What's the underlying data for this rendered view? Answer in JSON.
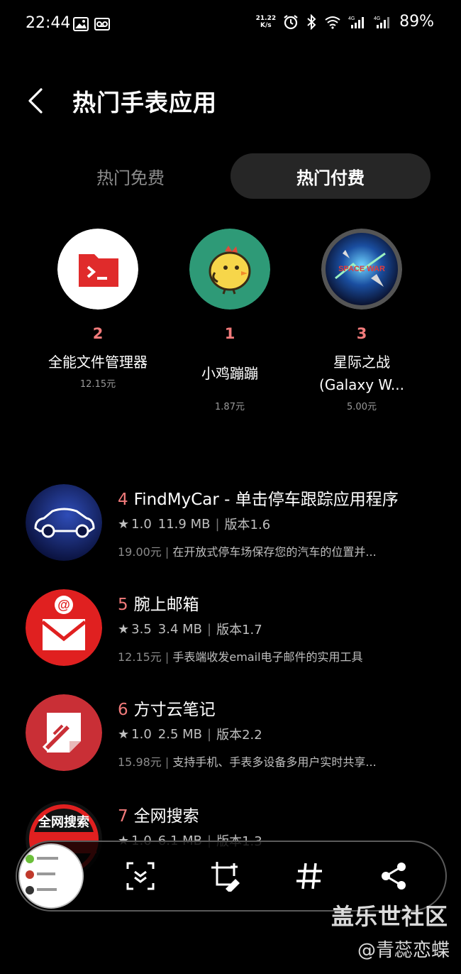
{
  "status": {
    "time": "22:44",
    "speed_top": "21.22",
    "speed_bottom": "K/s",
    "battery": "89%"
  },
  "header": {
    "title": "热门手表应用"
  },
  "tabs": [
    {
      "label": "热门免费",
      "active": false
    },
    {
      "label": "热门付费",
      "active": true
    }
  ],
  "top_apps": [
    {
      "rank": "2",
      "name": "全能文件管理器",
      "price": "12.15元",
      "icon": "folder-terminal-icon"
    },
    {
      "rank": "1",
      "name": "小鸡蹦蹦",
      "price": "1.87元",
      "icon": "chick-icon"
    },
    {
      "rank": "3",
      "name": "星际之战(Galaxy W...",
      "price": "5.00元",
      "icon": "space-war-icon"
    }
  ],
  "apps": [
    {
      "rank": "4",
      "name": "FindMyCar - 单击停车跟踪应用程序",
      "rating": "1.0",
      "size": "11.9 MB",
      "version": "版本1.6",
      "price": "19.00元",
      "desc": "在开放式停车场保存您的汽车的位置并..."
    },
    {
      "rank": "5",
      "name": "腕上邮箱",
      "rating": "3.5",
      "size": "3.4 MB",
      "version": "版本1.7",
      "price": "12.15元",
      "desc": "手表端收发email电子邮件的实用工具"
    },
    {
      "rank": "6",
      "name": "方寸云笔记",
      "rating": "1.0",
      "size": "2.5 MB",
      "version": "版本2.2",
      "price": "15.98元",
      "desc": "支持手机、手表多设备多用户实时共享..."
    },
    {
      "rank": "7",
      "name": "全网搜索",
      "rating": "1.0",
      "size": "6.1 MB",
      "version": "版本1.3",
      "price": "",
      "desc": ""
    }
  ],
  "icon7_text": "全网搜索",
  "watermark": {
    "line1": "盖乐世社区",
    "line2": "@青蕊恋蝶"
  },
  "colors": {
    "rank": "#f27b7b",
    "tab_active_bg": "#262626",
    "background": "#000000"
  }
}
